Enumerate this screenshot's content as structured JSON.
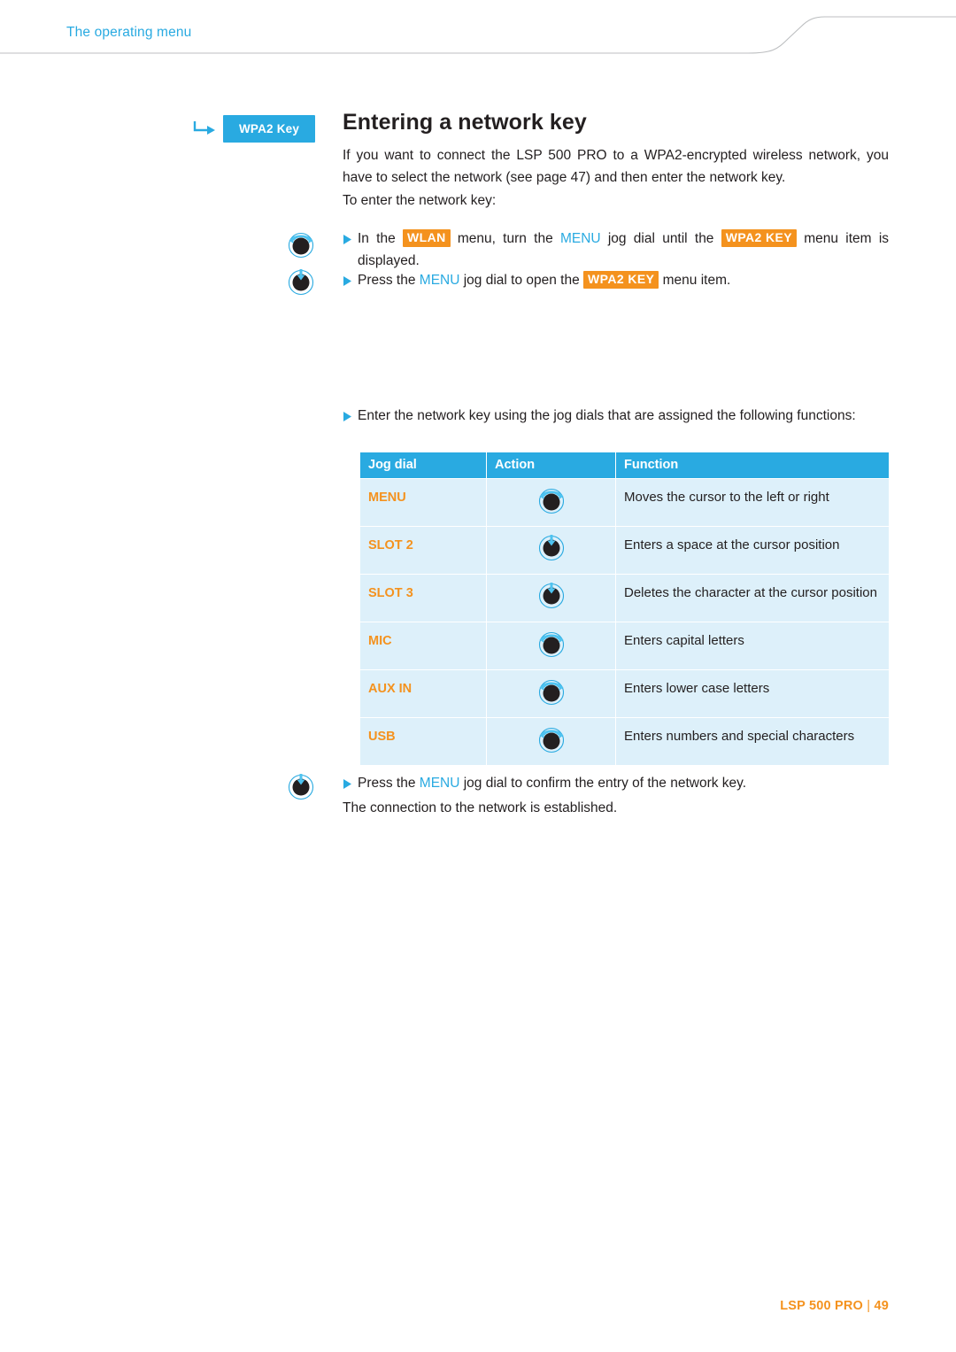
{
  "header": {
    "running_title": "The operating menu",
    "accent_color": "#29aae1"
  },
  "menu_tag": {
    "label": "WPA2 Key"
  },
  "page": {
    "headline": "Entering a network key",
    "intro": "If you want to connect the LSP 500 PRO to a WPA2-encrypted wireless network, you have to select the network (see page 47) and then enter the network key.",
    "to_enter": "To enter the network key:"
  },
  "steps": {
    "step1": {
      "pre": "In the ",
      "chip1": "WLAN",
      "mid1": " menu, turn the ",
      "menu_word": "MENU",
      "mid2": " jog dial until the ",
      "chip2": "WPA2 KEY",
      "post": " menu item is displayed."
    },
    "step2": {
      "pre": "Press the ",
      "menu_word": "MENU",
      "mid": " jog dial to open the ",
      "chip": "WPA2 KEY",
      "post": " menu item."
    },
    "step3": {
      "text": "Enter the network key using the jog dials that are assigned the following functions:"
    },
    "step4": {
      "pre": "Press the ",
      "menu_word": "MENU",
      "post": " jog dial to confirm the entry of the network key.",
      "result": "The connection to the network is established."
    }
  },
  "table": {
    "headers": [
      "Jog dial",
      "Action",
      "Function"
    ],
    "rows": [
      {
        "jog": "MENU",
        "action_icon": "jog-dial-turn-icon",
        "function": "Moves the cursor to the left or right"
      },
      {
        "jog": "SLOT 2",
        "action_icon": "jog-dial-press-icon",
        "function": "Enters a space at the cursor position"
      },
      {
        "jog": "SLOT 3",
        "action_icon": "jog-dial-press-icon",
        "function": "Deletes the character at the cursor position"
      },
      {
        "jog": "MIC",
        "action_icon": "jog-dial-turn-icon",
        "function": "Enters capital letters"
      },
      {
        "jog": "AUX IN",
        "action_icon": "jog-dial-turn-icon",
        "function": "Enters lower case letters"
      },
      {
        "jog": "USB",
        "action_icon": "jog-dial-turn-icon",
        "function": "Enters numbers and special characters"
      }
    ]
  },
  "footer": {
    "product": "LSP 500 PRO",
    "separator": "|",
    "page_number": "49"
  },
  "colors": {
    "accent_blue": "#29aae1",
    "accent_orange": "#f4921e",
    "table_cell": "#ddf0fa"
  }
}
